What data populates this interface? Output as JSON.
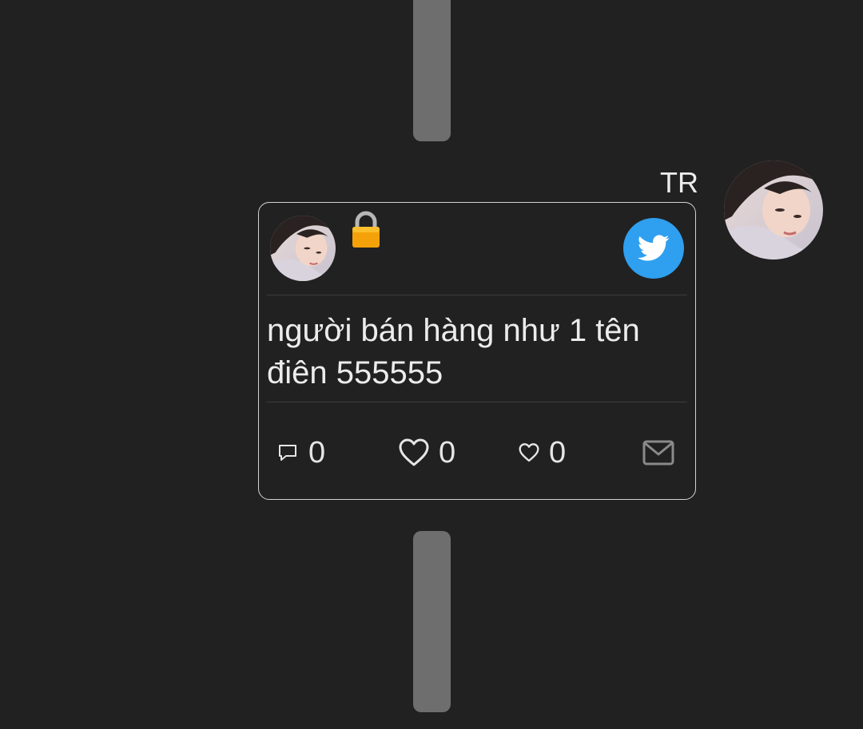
{
  "sender": {
    "name": "TR"
  },
  "tweet": {
    "text_line1": "người bán hàng như 1 tên",
    "text_line2": "điên 555555",
    "locked": true,
    "source_icon": "twitter-bird-icon",
    "actions": {
      "reply_count": "0",
      "like_count": "0",
      "small_like_count": "0"
    }
  },
  "colors": {
    "background": "#212121",
    "twitter_blue": "#2f9ff0",
    "scroll_handle": "#6e6e6e",
    "text": "#ececec"
  }
}
